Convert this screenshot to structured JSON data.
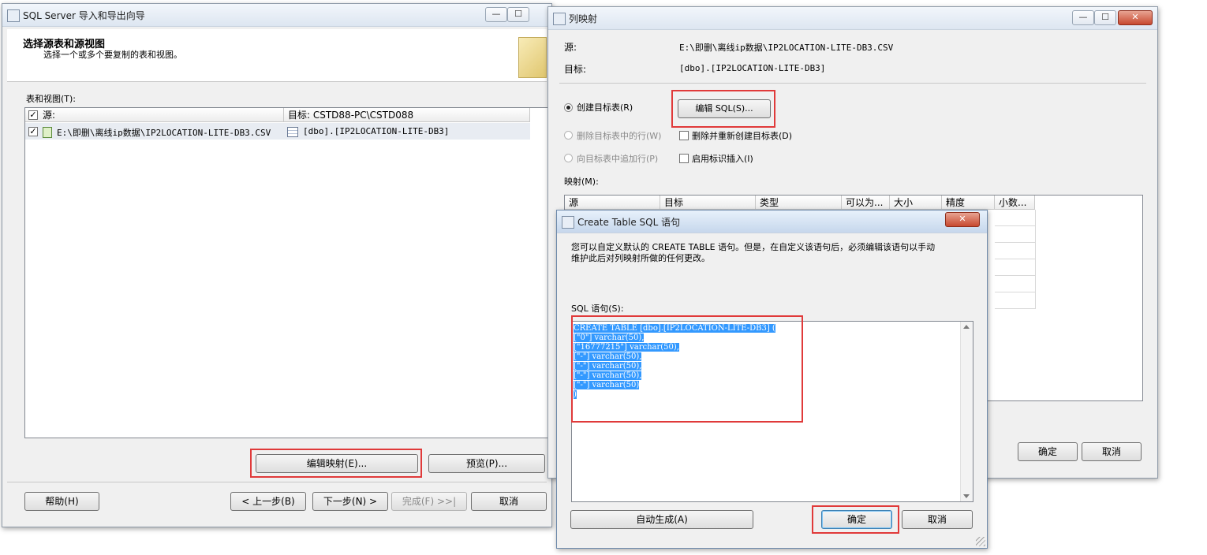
{
  "wizard": {
    "title": "SQL Server 导入和导出向导",
    "heading": "选择源表和源视图",
    "subheading": "选择一个或多个要复制的表和视图。",
    "tables_label": "表和视图(T):",
    "col_source": "源:",
    "col_target": "目标: CSTD88-PC\\CSTD088",
    "row_source": "E:\\即删\\离线ip数据\\IP2LOCATION-LITE-DB3.CSV",
    "row_target": "[dbo].[IP2LOCATION-LITE-DB3]",
    "edit_mapping": "编辑映射(E)...",
    "preview": "预览(P)...",
    "help": "帮助(H)",
    "back": "< 上一步(B)",
    "next": "下一步(N) >",
    "finish": "完成(F) >>|",
    "cancel": "取消"
  },
  "mapping": {
    "title": "列映射",
    "source_label": "源:",
    "source_value": "E:\\即删\\离线ip数据\\IP2LOCATION-LITE-DB3.CSV",
    "target_label": "目标:",
    "target_value": "[dbo].[IP2LOCATION-LITE-DB3]",
    "create_radio": "创建目标表(R)",
    "edit_sql": "编辑 SQL(S)...",
    "delete_rows": "删除目标表中的行(W)",
    "drop_recreate": "删除并重新创建目标表(D)",
    "append_rows": "向目标表中追加行(P)",
    "identity_insert": "启用标识插入(I)",
    "mappings_label": "映射(M):",
    "columns": [
      "源",
      "目标",
      "类型",
      "可以为...",
      "大小",
      "精度",
      "小数..."
    ],
    "ok": "确定",
    "cancel": "取消"
  },
  "sql_dialog": {
    "title": "Create Table SQL 语句",
    "description_line1": "您可以自定义默认的 CREATE TABLE 语句。但是，在自定义该语句后，必须编辑该语句以手动",
    "description_line2": "维护此后对列映射所做的任何更改。",
    "sql_label": "SQL 语句(S):",
    "sql_lines": [
      "CREATE TABLE [dbo].[IP2LOCATION-LITE-DB3] (",
      "[\"0\"] varchar(50),",
      "[\"16777215\"] varchar(50),",
      "[\"-\"] varchar(50),",
      "[\"-\"] varchar(50),",
      "[\"-\"] varchar(50),",
      "[\"-\"] varchar(50)",
      ")"
    ],
    "auto_generate": "自动生成(A)",
    "ok": "确定",
    "cancel": "取消"
  }
}
